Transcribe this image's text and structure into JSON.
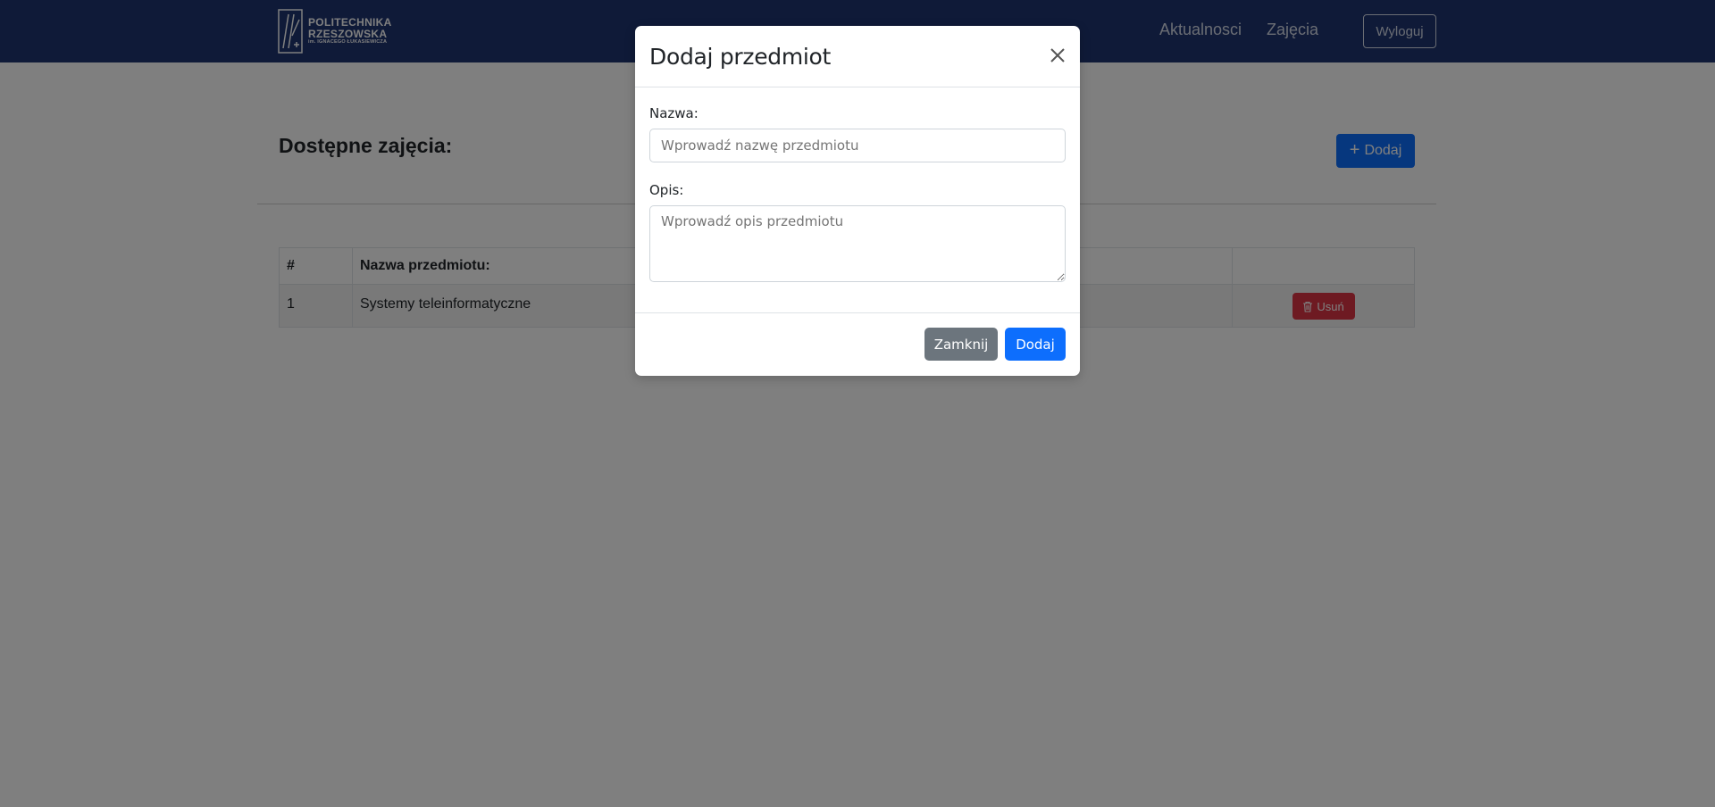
{
  "navbar": {
    "logo": {
      "line1": "POLITECHNIKA",
      "line2": "RZESZOWSKA",
      "line3": "im. IGNACEGO ŁUKASIEWICZA"
    },
    "links": [
      "Aktualnosci",
      "Zajęcia"
    ],
    "logout_label": "Wyloguj"
  },
  "page": {
    "title": "Dostępne zajęcia:",
    "add_button_label": "Dodaj",
    "add_button_icon": "plus-icon"
  },
  "table": {
    "headers": [
      "#",
      "Nazwa przedmiotu:",
      ""
    ],
    "rows": [
      {
        "num": "1",
        "name": "Systemy teleinformatyczne",
        "delete_label": "Usuń",
        "delete_icon": "trash-icon"
      }
    ]
  },
  "modal": {
    "title": "Dodaj przedmiot",
    "close_icon": "close-icon",
    "name_label": "Nazwa:",
    "name_value": "",
    "name_placeholder": "Wprowadź nazwę przedmiotu",
    "desc_label": "Opis:",
    "desc_value": "",
    "desc_placeholder": "Wprowadź opis przedmiotu",
    "close_button_label": "Zamknij",
    "save_button_label": "Dodaj"
  },
  "colors": {
    "navbar_bg": "#1e3470",
    "primary": "#0d6efd",
    "secondary": "#6c757d",
    "danger": "#dc3545"
  }
}
